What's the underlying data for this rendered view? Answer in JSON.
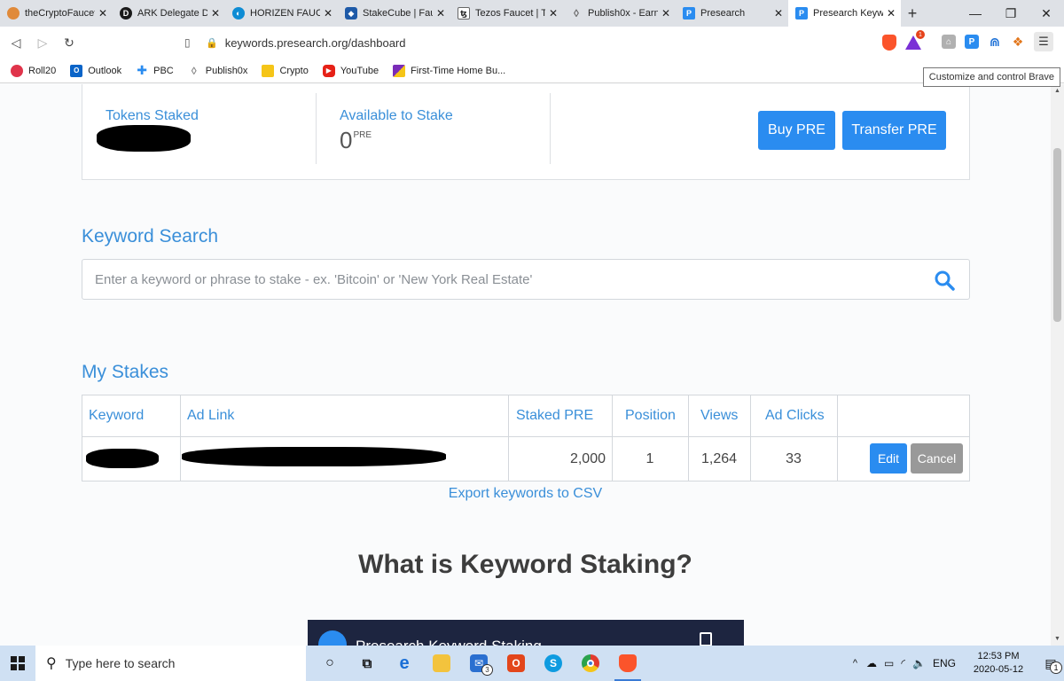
{
  "browser": {
    "tabs": [
      {
        "title": "theCryptoFaucet",
        "icon": "coin-face-icon",
        "color": "#e08a3a"
      },
      {
        "title": "ARK Delegate Da",
        "icon": "ark-d-icon",
        "color": "#1a1a1a"
      },
      {
        "title": "HORIZEN FAUCE",
        "icon": "horizen-icon",
        "color": "#0e8cd4"
      },
      {
        "title": "StakeCube | Fau",
        "icon": "shield-icon",
        "color": "#1e5aa8"
      },
      {
        "title": "Tezos Faucet | Te",
        "icon": "tezos-icon",
        "color": "#2c2c2c"
      },
      {
        "title": "Publish0x - Earn",
        "icon": "drop-icon",
        "color": "#666666"
      },
      {
        "title": "Presearch",
        "icon": "presearch-p-icon",
        "color": "#2a8cf0"
      },
      {
        "title": "Presearch Keywo",
        "icon": "presearch-p-icon",
        "color": "#2a8cf0"
      }
    ],
    "new_tab": "+",
    "url": "keywords.presearch.org/dashboard",
    "bookmarks": [
      {
        "label": "Roll20",
        "color": "#e0344b"
      },
      {
        "label": "Outlook",
        "color": "#0a64c8"
      },
      {
        "label": "PBC",
        "color": "#2a8cf0"
      },
      {
        "label": "Publish0x",
        "color": "#888888"
      },
      {
        "label": "Crypto",
        "color": "#f5c518"
      },
      {
        "label": "YouTube",
        "color": "#e62117"
      },
      {
        "label": "First-Time Home Bu...",
        "color": "#7a2cb8"
      }
    ],
    "tooltip": "Customize and control Brave",
    "rewards_badge": "1"
  },
  "dashboard": {
    "tokens_staked_label": "Tokens Staked",
    "available_label": "Available to Stake",
    "available_value": "0",
    "currency_unit": "PRE",
    "buy_button": "Buy PRE",
    "transfer_button": "Transfer PRE",
    "accent_color": "#2a8cf0"
  },
  "keyword_search": {
    "title": "Keyword Search",
    "placeholder": "Enter a keyword or phrase to stake - ex. 'Bitcoin' or 'New York Real Estate'"
  },
  "stakes": {
    "title": "My Stakes",
    "columns": [
      "Keyword",
      "Ad Link",
      "Staked PRE",
      "Position",
      "Views",
      "Ad Clicks"
    ],
    "rows": [
      {
        "staked": "2,000",
        "position": "1",
        "views": "1,264",
        "clicks": "33",
        "edit": "Edit",
        "cancel": "Cancel"
      }
    ],
    "export_link": "Export keywords to CSV"
  },
  "info": {
    "heading": "What is Keyword Staking?",
    "video_title": "Presearch Keyword Staking"
  },
  "taskbar": {
    "search_placeholder": "Type here to search",
    "mail_badge": "3",
    "language": "ENG",
    "time": "12:53 PM",
    "date": "2020-05-12",
    "notification_badge": "1"
  }
}
